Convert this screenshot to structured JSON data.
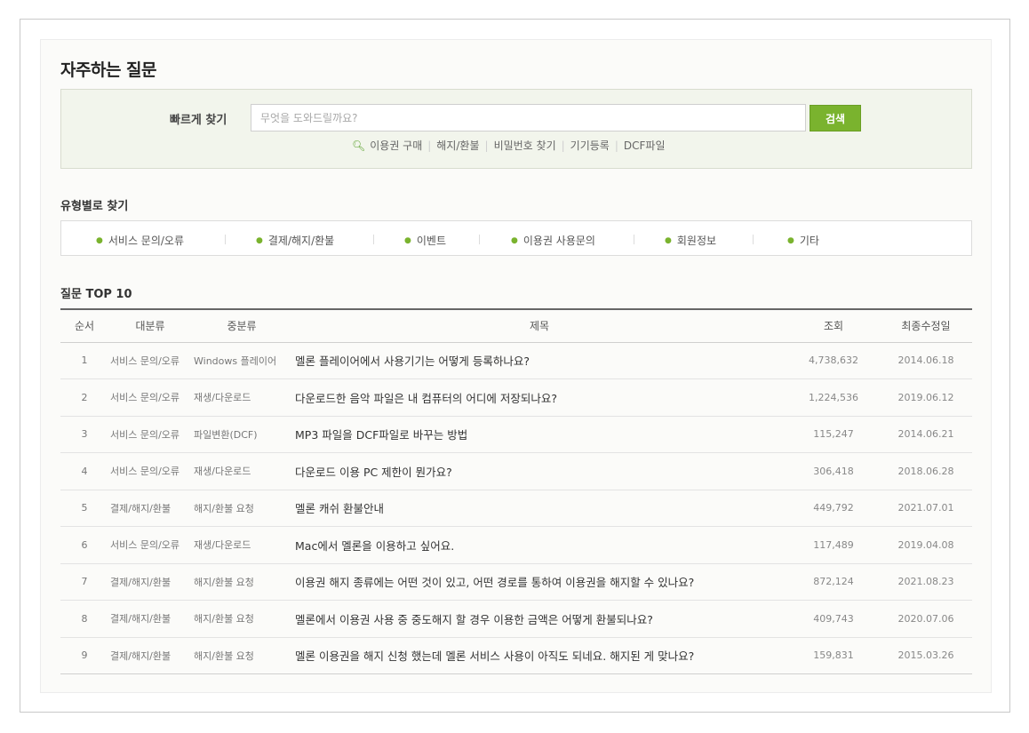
{
  "page": {
    "title": "자주하는 질문"
  },
  "quick_search": {
    "label": "빠르게 찾기",
    "placeholder": "무엇을 도와드릴까요?",
    "button": "검색",
    "links": [
      "이용권 구매",
      "해지/환불",
      "비밀번호 찾기",
      "기기등록",
      "DCF파일"
    ]
  },
  "type_section": {
    "title": "유형별로 찾기",
    "items": [
      "서비스 문의/오류",
      "결제/해지/환불",
      "이벤트",
      "이용권 사용문의",
      "회원정보",
      "기타"
    ]
  },
  "top10": {
    "title": "질문 TOP 10",
    "headers": [
      "순서",
      "대분류",
      "중분류",
      "제목",
      "조회",
      "최종수정일"
    ],
    "rows": [
      {
        "num": "1",
        "cat1": "서비스 문의/오류",
        "cat2": "Windows 플레이어",
        "title": "멜론 플레이어에서 사용기기는 어떻게 등록하나요?",
        "views": "4,738,632",
        "date": "2014.06.18"
      },
      {
        "num": "2",
        "cat1": "서비스 문의/오류",
        "cat2": "재생/다운로드",
        "title": "다운로드한 음악 파일은 내 컴퓨터의 어디에 저장되나요?",
        "views": "1,224,536",
        "date": "2019.06.12"
      },
      {
        "num": "3",
        "cat1": "서비스 문의/오류",
        "cat2": "파일변환(DCF)",
        "title": "MP3 파일을 DCF파일로 바꾸는 방법",
        "views": "115,247",
        "date": "2014.06.21"
      },
      {
        "num": "4",
        "cat1": "서비스 문의/오류",
        "cat2": "재생/다운로드",
        "title": "다운로드 이용 PC 제한이 뭔가요?",
        "views": "306,418",
        "date": "2018.06.28"
      },
      {
        "num": "5",
        "cat1": "결제/해지/환불",
        "cat2": "해지/환불 요청",
        "title": "멜론 캐쉬 환불안내",
        "views": "449,792",
        "date": "2021.07.01"
      },
      {
        "num": "6",
        "cat1": "서비스 문의/오류",
        "cat2": "재생/다운로드",
        "title": "Mac에서 멜론을 이용하고 싶어요.",
        "views": "117,489",
        "date": "2019.04.08"
      },
      {
        "num": "7",
        "cat1": "결제/해지/환불",
        "cat2": "해지/환불 요청",
        "title": "이용권 해지 종류에는 어떤 것이 있고, 어떤 경로를 통하여 이용권을 해지할 수 있나요?",
        "views": "872,124",
        "date": "2021.08.23"
      },
      {
        "num": "8",
        "cat1": "결제/해지/환불",
        "cat2": "해지/환불 요청",
        "title": "멜론에서 이용권 사용 중 중도해지 할 경우 이용한 금액은 어떻게 환불되나요?",
        "views": "409,743",
        "date": "2020.07.06"
      },
      {
        "num": "9",
        "cat1": "결제/해지/환불",
        "cat2": "해지/환불 요청",
        "title": "멜론 이용권을 해지 신청 했는데 멜론 서비스 사용이 아직도 되네요. 해지된 게 맞나요?",
        "views": "159,831",
        "date": "2015.03.26"
      }
    ]
  }
}
